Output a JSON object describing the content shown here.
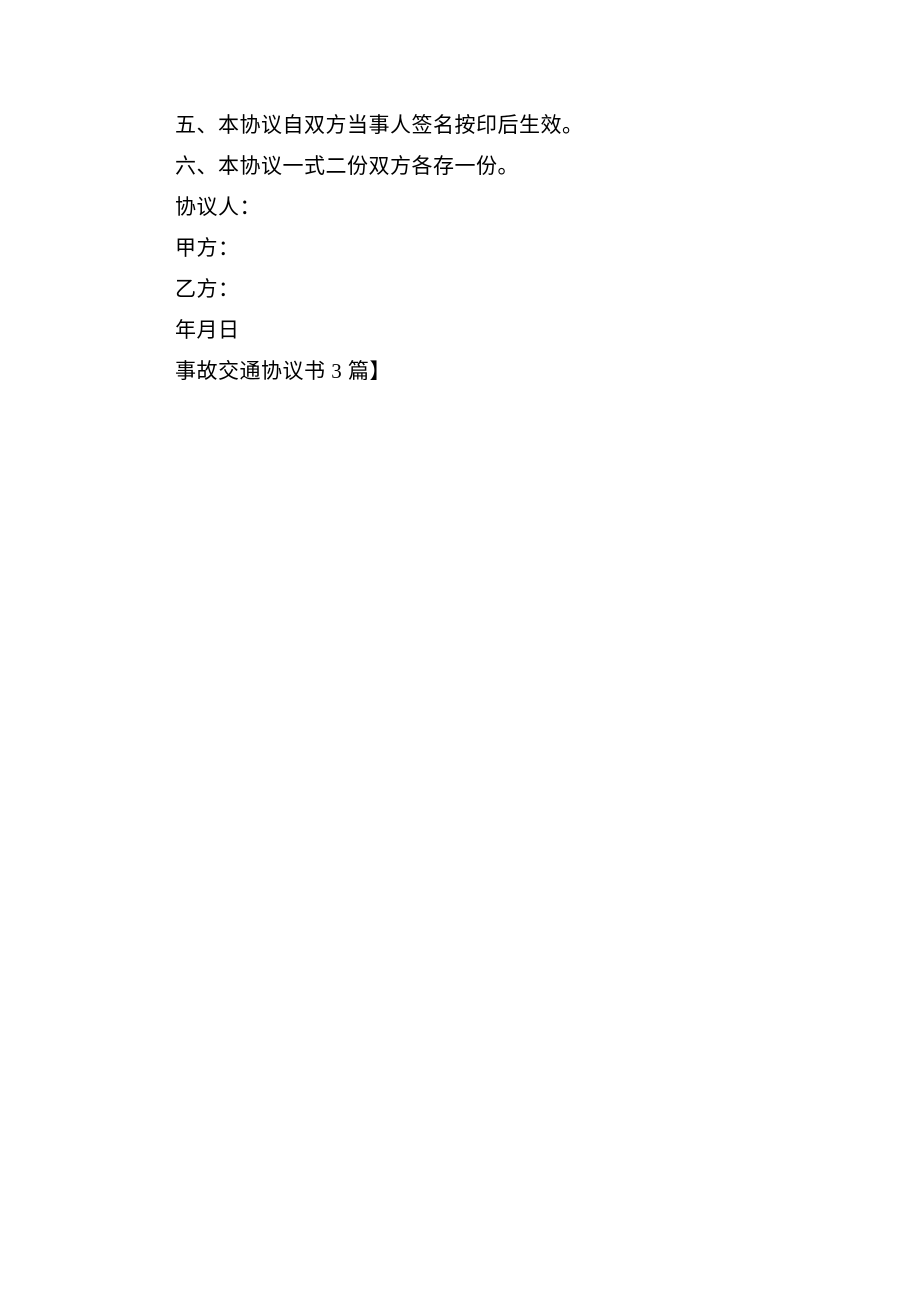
{
  "lines": [
    "五、本协议自双方当事人签名按印后生效。",
    "六、本协议一式二份双方各存一份。",
    "协议人：",
    "甲方：",
    "乙方：",
    "年月日",
    "事故交通协议书 3 篇】"
  ]
}
